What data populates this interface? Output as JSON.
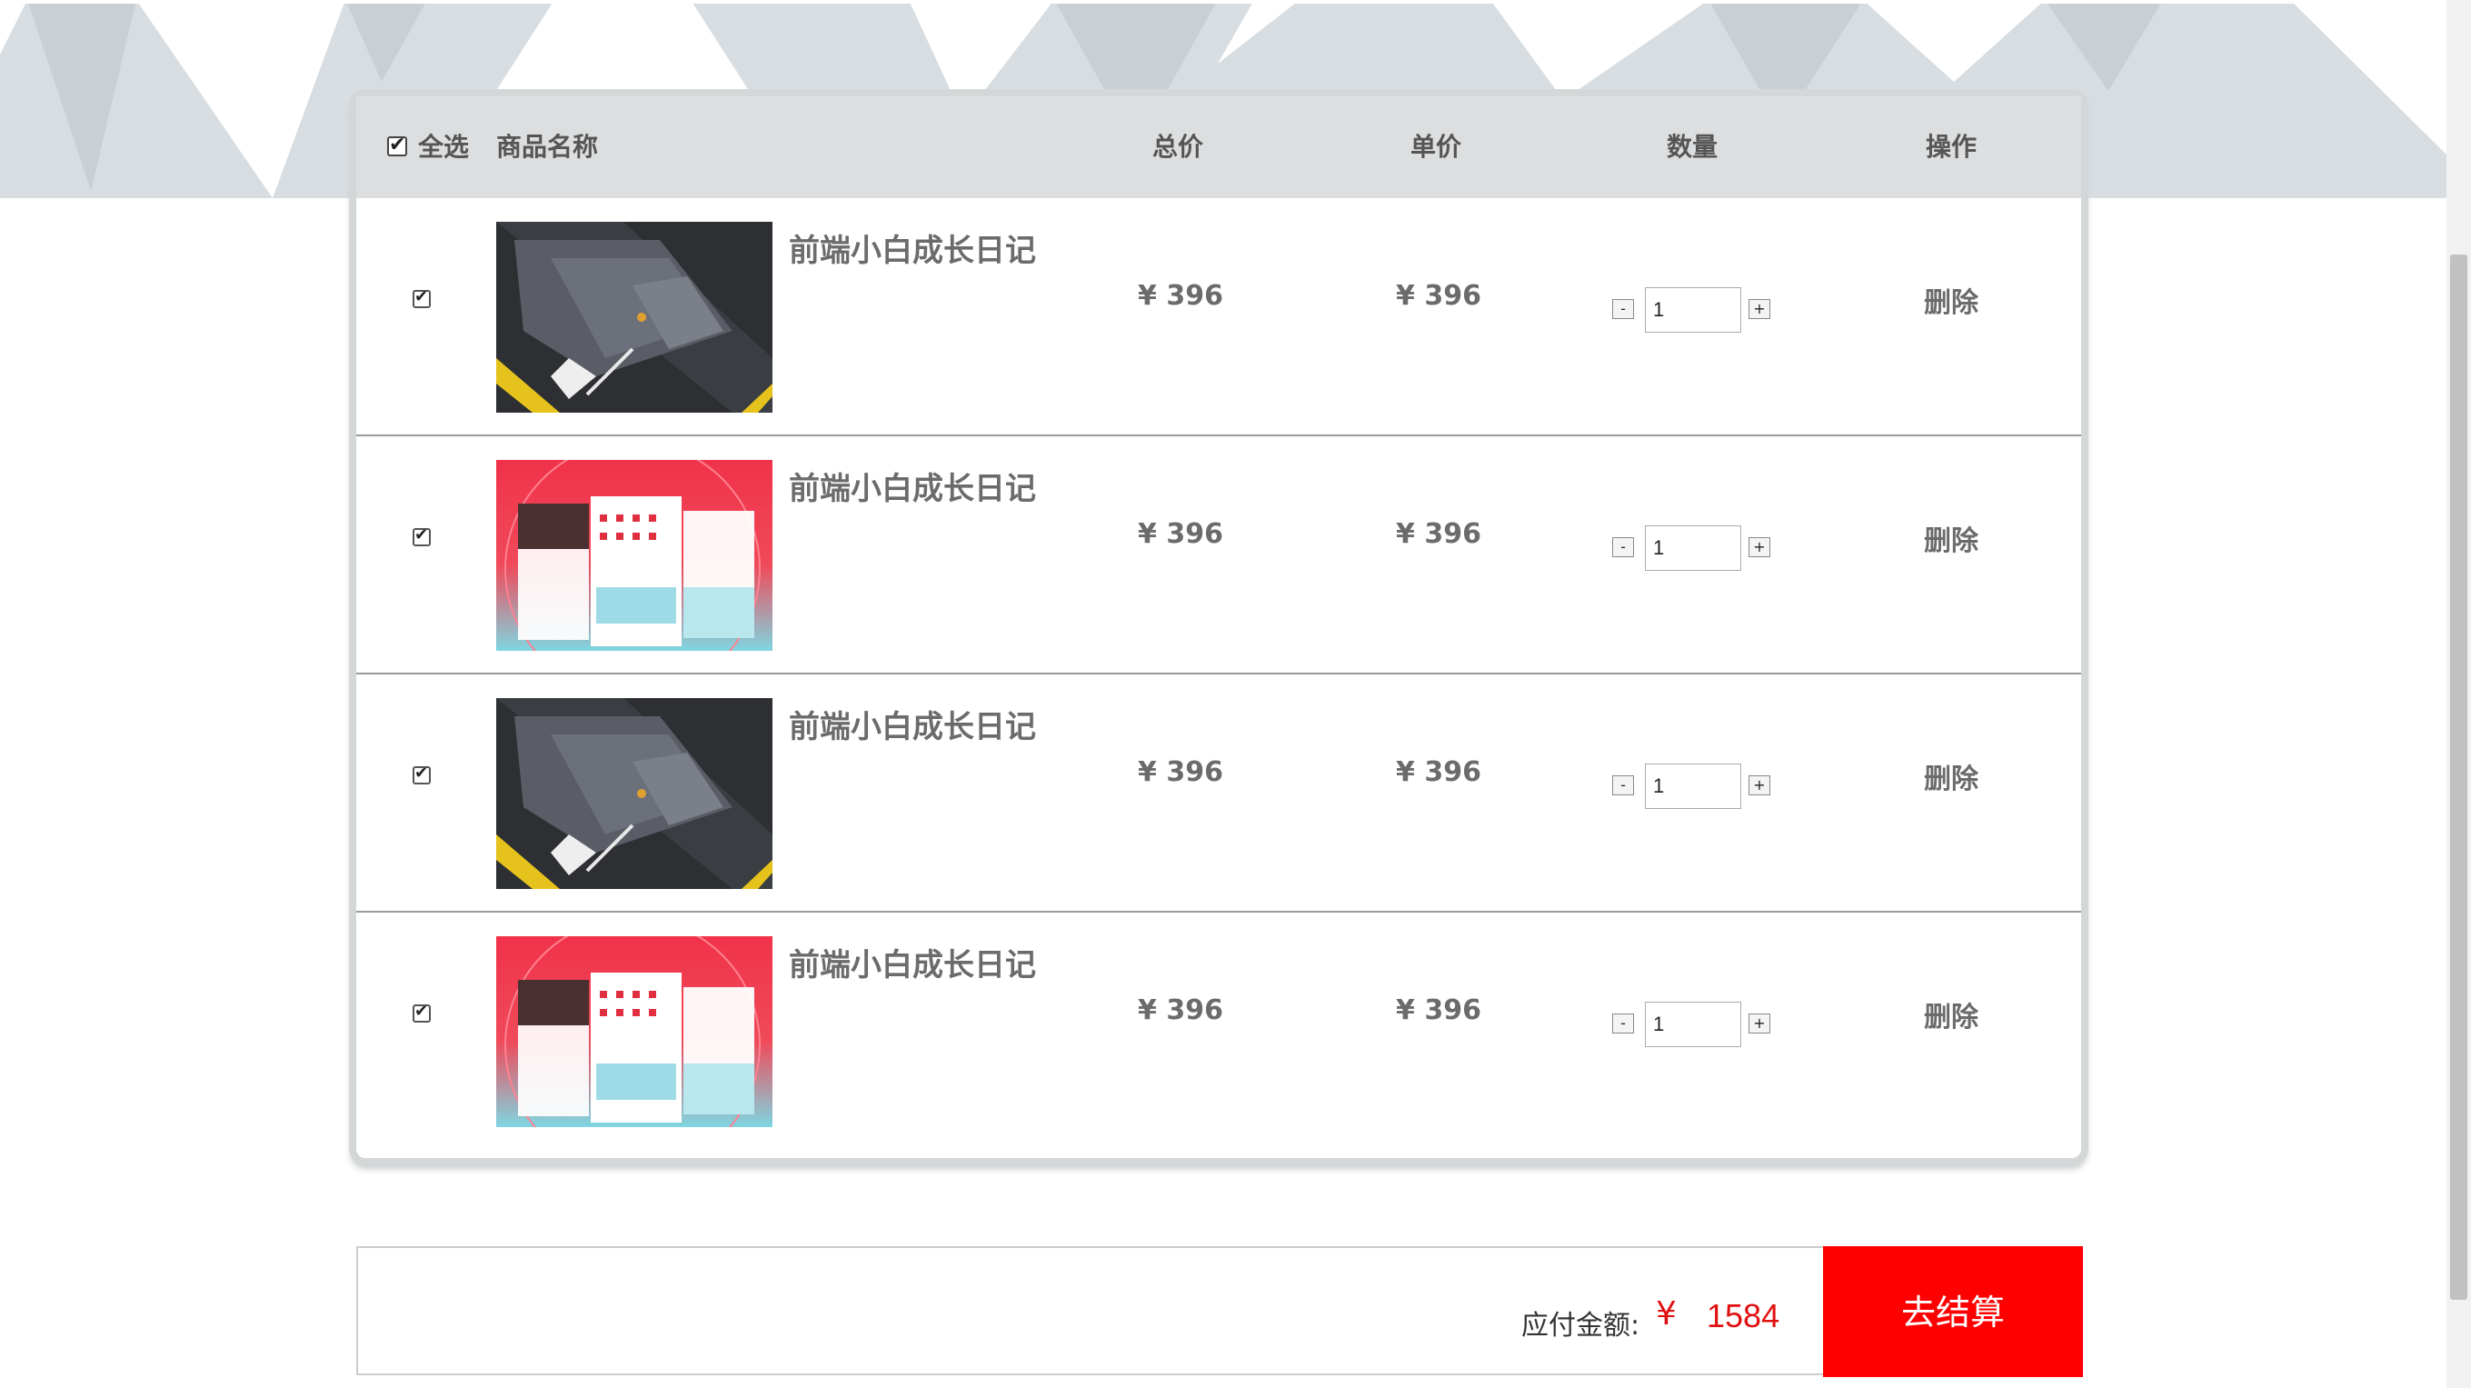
{
  "cart": {
    "header": {
      "select_all": "全选",
      "product_name": "商品名称",
      "total_price": "总价",
      "unit_price": "单价",
      "quantity": "数量",
      "action": "操作"
    },
    "items": [
      {
        "name": "前端小白成长日记",
        "total": "¥ 396",
        "unit": "¥ 396",
        "qty": "1",
        "delete": "删除",
        "checked": true,
        "image": "dark-desk-image",
        "qty_minus": "-",
        "qty_plus": "+"
      },
      {
        "name": "前端小白成长日记",
        "total": "¥ 396",
        "unit": "¥ 396",
        "qty": "1",
        "delete": "删除",
        "checked": true,
        "image": "red-app-ui-image",
        "qty_minus": "-",
        "qty_plus": "+"
      },
      {
        "name": "前端小白成长日记",
        "total": "¥ 396",
        "unit": "¥ 396",
        "qty": "1",
        "delete": "删除",
        "checked": true,
        "image": "dark-desk-image",
        "qty_minus": "-",
        "qty_plus": "+"
      },
      {
        "name": "前端小白成长日记",
        "total": "¥ 396",
        "unit": "¥ 396",
        "qty": "1",
        "delete": "删除",
        "checked": true,
        "image": "red-app-ui-image",
        "qty_minus": "-",
        "qty_plus": "+"
      }
    ]
  },
  "footer": {
    "pay_label": "应付金额:",
    "currency": "¥",
    "amount": "1584",
    "checkout_label": "去结算"
  },
  "colors": {
    "accent": "#ff0000",
    "header_bg": "#dcdedf",
    "band_bg": "#d7dde1"
  }
}
